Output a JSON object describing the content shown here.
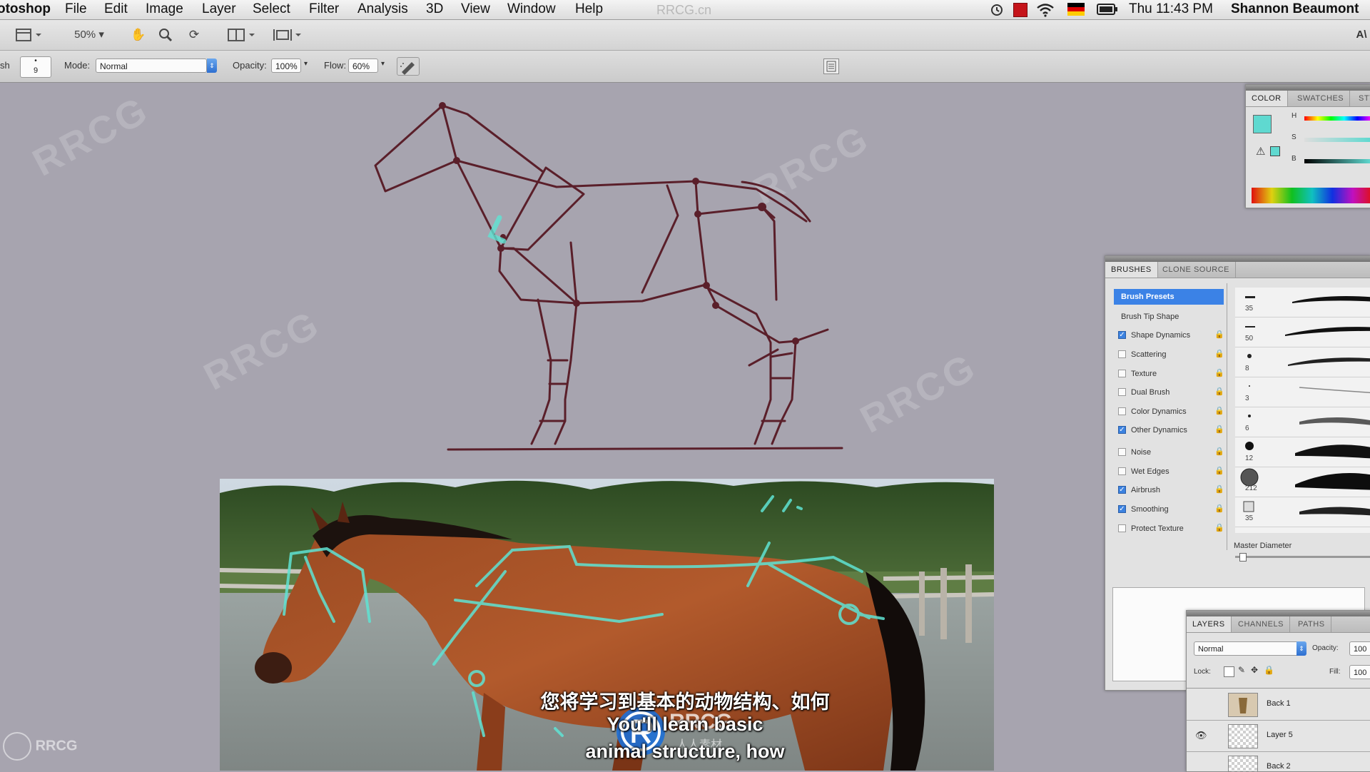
{
  "menubar": {
    "app_name": "otoshop",
    "items": [
      "File",
      "Edit",
      "Image",
      "Layer",
      "Select",
      "Filter",
      "Analysis",
      "3D",
      "View",
      "Window",
      "Help"
    ],
    "watermark": "RRCG.cn",
    "clock": "Thu 11:43 PM",
    "user": "Shannon Beaumont"
  },
  "appbar": {
    "zoom": "50%",
    "right_cut": "A\\"
  },
  "options": {
    "brush_size": "9",
    "mode_label": "Mode:",
    "mode_value": "Normal",
    "opacity_label": "Opacity:",
    "opacity_value": "100%",
    "flow_label": "Flow:",
    "flow_value": "60%"
  },
  "color_panel": {
    "tabs": [
      "COLOR",
      "SWATCHES",
      "STYL"
    ],
    "channels": [
      "H",
      "S",
      "B"
    ],
    "foreground": "#5fd9d0"
  },
  "brushes_panel": {
    "tabs": [
      "BRUSHES",
      "CLONE SOURCE"
    ],
    "presets_label": "Brush Presets",
    "tip_shape_label": "Brush Tip Shape",
    "options": [
      {
        "label": "Shape Dynamics",
        "checked": true
      },
      {
        "label": "Scattering",
        "checked": false
      },
      {
        "label": "Texture",
        "checked": false
      },
      {
        "label": "Dual Brush",
        "checked": false
      },
      {
        "label": "Color Dynamics",
        "checked": false
      },
      {
        "label": "Other Dynamics",
        "checked": true
      },
      {
        "label": "Noise",
        "checked": false
      },
      {
        "label": "Wet Edges",
        "checked": false
      },
      {
        "label": "Airbrush",
        "checked": true
      },
      {
        "label": "Smoothing",
        "checked": true
      },
      {
        "label": "Protect Texture",
        "checked": false
      }
    ],
    "preset_sizes": [
      "35",
      "50",
      "8",
      "3",
      "6",
      "12",
      "212",
      "35"
    ],
    "master_diameter_label": "Master Diameter"
  },
  "layers_panel": {
    "tabs": [
      "LAYERS",
      "CHANNELS",
      "PATHS"
    ],
    "blend_mode": "Normal",
    "opacity_label": "Opacity:",
    "opacity_value": "100",
    "lock_label": "Lock:",
    "fill_label": "Fill:",
    "fill_value": "100",
    "layers": [
      "Back 1",
      "Layer 5",
      "Back 2"
    ]
  },
  "subtitles": {
    "chinese": "您将学习到基本的动物结构、如何",
    "english_line1": "You'll learn basic",
    "english_line2": "animal structure, how"
  },
  "overlay": {
    "logo_text": "RRCG",
    "logo_sub": "人人素材",
    "corner_logo": "RRCG"
  },
  "colors": {
    "canvas_bg": "#a7a4af",
    "sketch_stroke": "#5a1f2a",
    "guide_cyan": "#5fe3d3"
  }
}
